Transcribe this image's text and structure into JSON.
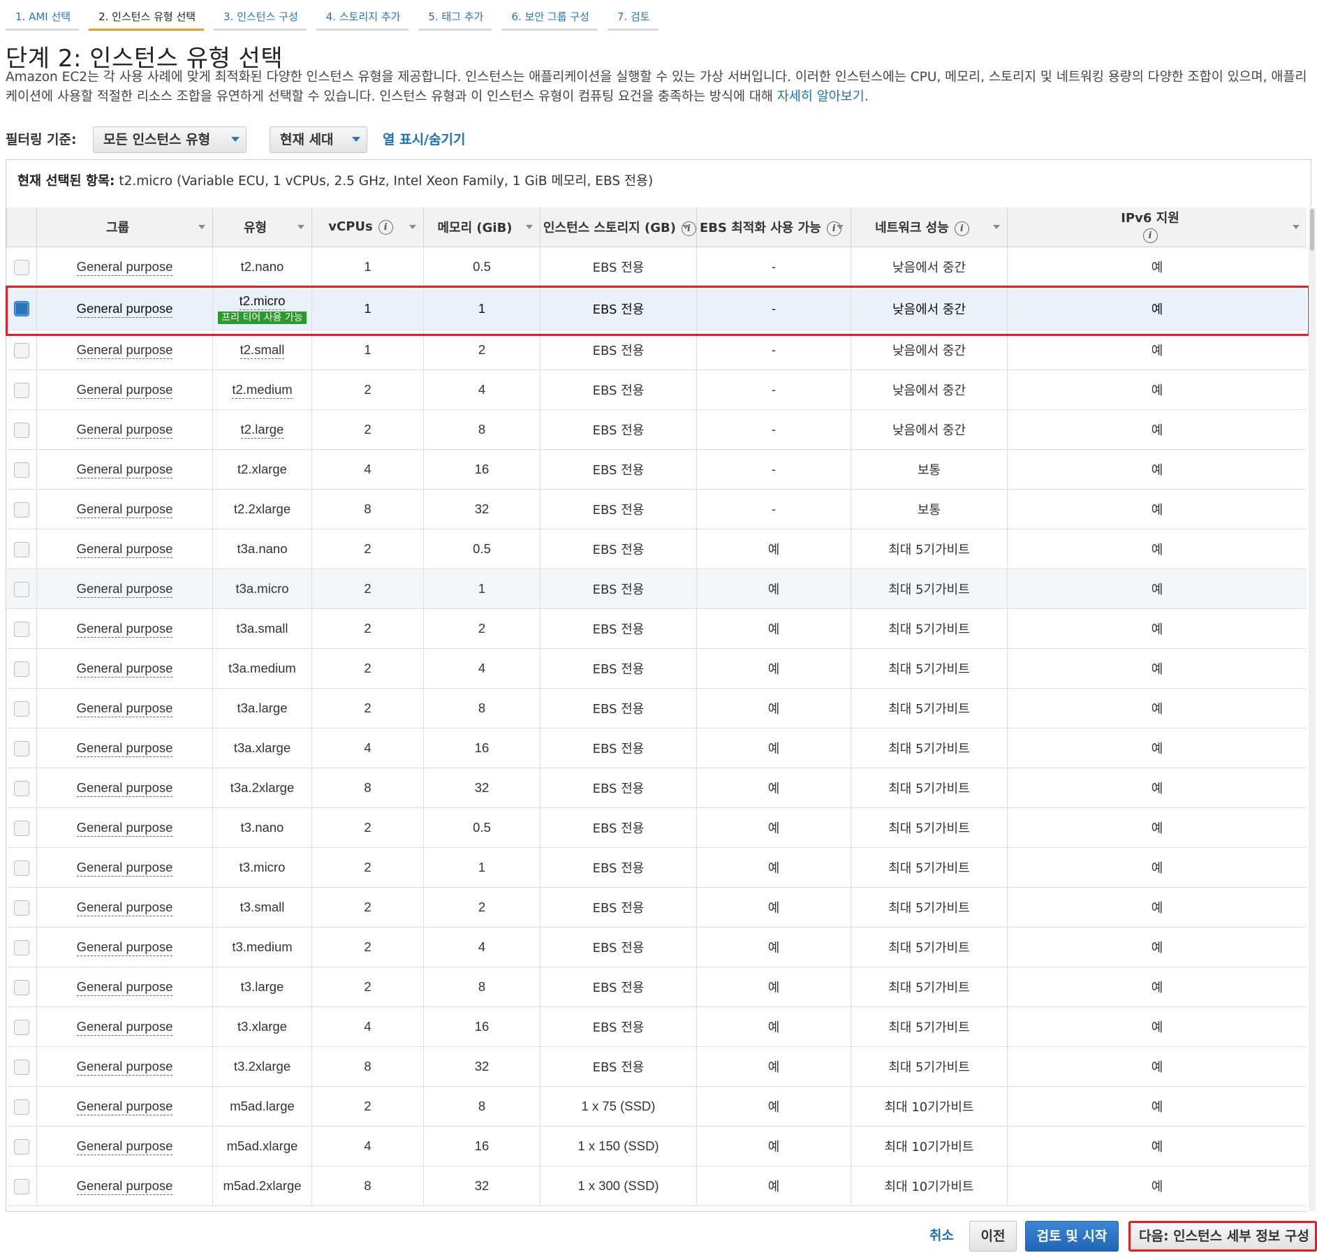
{
  "steps": [
    {
      "label": "1. AMI 선택"
    },
    {
      "label": "2. 인스턴스 유형 선택"
    },
    {
      "label": "3. 인스턴스 구성"
    },
    {
      "label": "4. 스토리지 추가"
    },
    {
      "label": "5. 태그 추가"
    },
    {
      "label": "6. 보안 그룹 구성"
    },
    {
      "label": "7. 검토"
    }
  ],
  "active_step": 1,
  "page": {
    "title": "단계 2: 인스턴스 유형 선택",
    "description": "Amazon EC2는 각 사용 사례에 맞게 최적화된 다양한 인스턴스 유형을 제공합니다. 인스턴스는 애플리케이션을 실행할 수 있는 가상 서버입니다. 이러한 인스턴스에는 CPU, 메모리, 스토리지 및 네트워킹 용량의 다양한 조합이 있으며, 애플리케이션에 사용할 적절한 리소스 조합을 유연하게 선택할 수 있습니다. 인스턴스 유형과 이 인스턴스 유형이 컴퓨팅 요건을 충족하는 방식에 대해 ",
    "learn_more": "자세히 알아보기",
    "description_end": "."
  },
  "filter": {
    "label": "필터링 기준:",
    "type_value": "모든 인스턴스 유형",
    "generation_value": "현재 세대",
    "columns_toggle": "열 표시/숨기기"
  },
  "selected": {
    "label": "현재 선택된 항목:",
    "value": "t2.micro (Variable ECU, 1 vCPUs, 2.5 GHz, Intel Xeon Family, 1 GiB 메모리, EBS 전용)"
  },
  "table": {
    "headers": [
      "그룹",
      "유형",
      "vCPUs",
      "메모리 (GiB)",
      "인스턴스 스토리지 (GB)",
      "EBS 최적화 사용 가능",
      "네트워크 성능",
      "IPv6 지원"
    ],
    "free_tier_badge": "프리 티어 사용 가능",
    "selected_row": 1,
    "hover_row": 8,
    "rows": [
      [
        "General purpose",
        "t2.nano",
        "1",
        "0.5",
        "EBS 전용",
        "-",
        "낮음에서 중간",
        "예"
      ],
      [
        "General purpose",
        "t2.micro",
        "1",
        "1",
        "EBS 전용",
        "-",
        "낮음에서 중간",
        "예"
      ],
      [
        "General purpose",
        "t2.small",
        "1",
        "2",
        "EBS 전용",
        "-",
        "낮음에서 중간",
        "예"
      ],
      [
        "General purpose",
        "t2.medium",
        "2",
        "4",
        "EBS 전용",
        "-",
        "낮음에서 중간",
        "예"
      ],
      [
        "General purpose",
        "t2.large",
        "2",
        "8",
        "EBS 전용",
        "-",
        "낮음에서 중간",
        "예"
      ],
      [
        "General purpose",
        "t2.xlarge",
        "4",
        "16",
        "EBS 전용",
        "-",
        "보통",
        "예"
      ],
      [
        "General purpose",
        "t2.2xlarge",
        "8",
        "32",
        "EBS 전용",
        "-",
        "보통",
        "예"
      ],
      [
        "General purpose",
        "t3a.nano",
        "2",
        "0.5",
        "EBS 전용",
        "예",
        "최대 5기가비트",
        "예"
      ],
      [
        "General purpose",
        "t3a.micro",
        "2",
        "1",
        "EBS 전용",
        "예",
        "최대 5기가비트",
        "예"
      ],
      [
        "General purpose",
        "t3a.small",
        "2",
        "2",
        "EBS 전용",
        "예",
        "최대 5기가비트",
        "예"
      ],
      [
        "General purpose",
        "t3a.medium",
        "2",
        "4",
        "EBS 전용",
        "예",
        "최대 5기가비트",
        "예"
      ],
      [
        "General purpose",
        "t3a.large",
        "2",
        "8",
        "EBS 전용",
        "예",
        "최대 5기가비트",
        "예"
      ],
      [
        "General purpose",
        "t3a.xlarge",
        "4",
        "16",
        "EBS 전용",
        "예",
        "최대 5기가비트",
        "예"
      ],
      [
        "General purpose",
        "t3a.2xlarge",
        "8",
        "32",
        "EBS 전용",
        "예",
        "최대 5기가비트",
        "예"
      ],
      [
        "General purpose",
        "t3.nano",
        "2",
        "0.5",
        "EBS 전용",
        "예",
        "최대 5기가비트",
        "예"
      ],
      [
        "General purpose",
        "t3.micro",
        "2",
        "1",
        "EBS 전용",
        "예",
        "최대 5기가비트",
        "예"
      ],
      [
        "General purpose",
        "t3.small",
        "2",
        "2",
        "EBS 전용",
        "예",
        "최대 5기가비트",
        "예"
      ],
      [
        "General purpose",
        "t3.medium",
        "2",
        "4",
        "EBS 전용",
        "예",
        "최대 5기가비트",
        "예"
      ],
      [
        "General purpose",
        "t3.large",
        "2",
        "8",
        "EBS 전용",
        "예",
        "최대 5기가비트",
        "예"
      ],
      [
        "General purpose",
        "t3.xlarge",
        "4",
        "16",
        "EBS 전용",
        "예",
        "최대 5기가비트",
        "예"
      ],
      [
        "General purpose",
        "t3.2xlarge",
        "8",
        "32",
        "EBS 전용",
        "예",
        "최대 5기가비트",
        "예"
      ],
      [
        "General purpose",
        "m5ad.large",
        "2",
        "8",
        "1 x 75 (SSD)",
        "예",
        "최대 10기가비트",
        "예"
      ],
      [
        "General purpose",
        "m5ad.xlarge",
        "4",
        "16",
        "1 x 150 (SSD)",
        "예",
        "최대 10기가비트",
        "예"
      ],
      [
        "General purpose",
        "m5ad.2xlarge",
        "8",
        "32",
        "1 x 300 (SSD)",
        "예",
        "최대 10기가비트",
        "예"
      ]
    ]
  },
  "buttons": {
    "cancel": "취소",
    "previous": "이전",
    "review_launch": "검토 및 시작",
    "next": "다음: 인스턴스 세부 정보 구성"
  },
  "colors": {
    "accent_blue": "#2a73bd",
    "active_step_underline": "#ec9a2c",
    "highlight_red": "#e01f26",
    "free_tier_green": "#2d9a2d"
  }
}
